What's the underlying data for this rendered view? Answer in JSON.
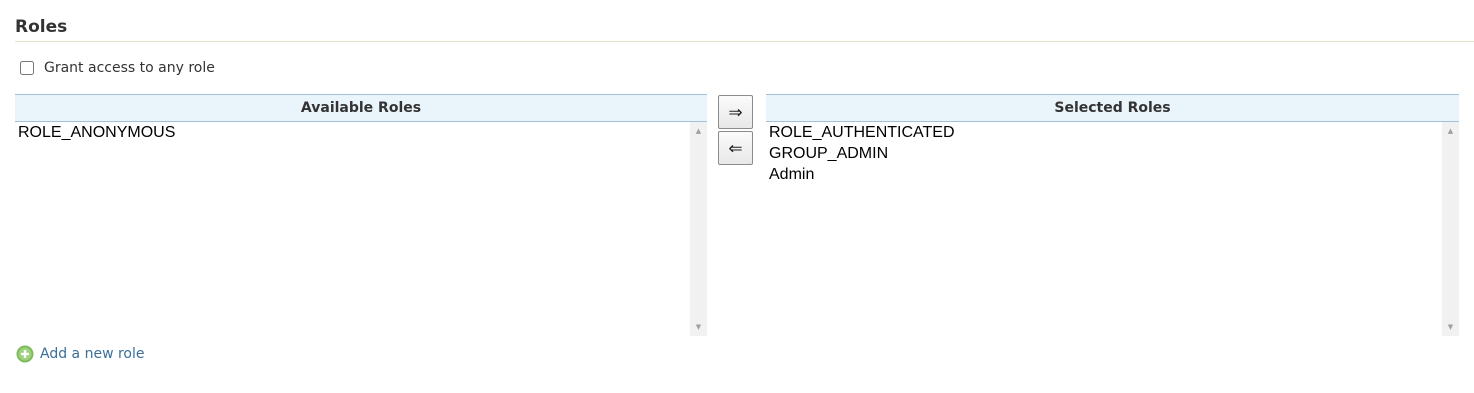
{
  "section": {
    "title": "Roles"
  },
  "grant_any": {
    "label": "Grant access to any role",
    "checked": false
  },
  "available": {
    "header": "Available Roles",
    "items": [
      "ROLE_ANONYMOUS"
    ]
  },
  "selected": {
    "header": "Selected Roles",
    "items": [
      "ROLE_AUTHENTICATED",
      "GROUP_ADMIN",
      "Admin"
    ]
  },
  "buttons": {
    "add_label": "⇒",
    "remove_label": "⇐"
  },
  "add_role": {
    "label": "Add a new role",
    "icon": "plus-circle-icon",
    "icon_color": "#7dbb5a"
  },
  "colors": {
    "link": "#3a6f9a",
    "header_bg": "#eaf4fb",
    "header_border": "#a3c0d4"
  }
}
